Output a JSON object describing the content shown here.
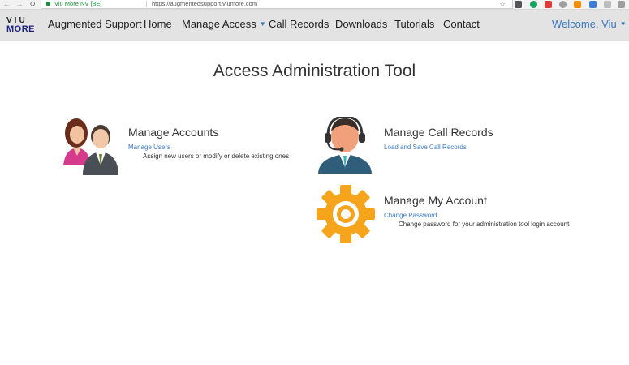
{
  "browser": {
    "site_identity": "Viu More NV [BE]",
    "url": "https://augmentedsupport.viumore.com"
  },
  "navbar": {
    "logo_top": "VIU",
    "logo_bottom": "MORE",
    "items": [
      {
        "label": "Augmented Support"
      },
      {
        "label": "Home"
      },
      {
        "label": "Manage Access"
      },
      {
        "label": "Call Records"
      },
      {
        "label": "Downloads"
      },
      {
        "label": "Tutorials"
      },
      {
        "label": "Contact"
      }
    ],
    "welcome": "Welcome, Viu"
  },
  "main": {
    "title": "Access Administration Tool",
    "cards": [
      {
        "title": "Manage Accounts",
        "link": "Manage Users",
        "description": "Assign new users or modify or delete existing ones",
        "icon": "users-icon"
      },
      {
        "title": "Manage Call Records",
        "link": "Load and Save Call Records",
        "description": "",
        "icon": "headset-operator-icon"
      },
      {
        "title": "Manage My Account",
        "link": "Change Password",
        "description": "Change password for your administration tool login account",
        "icon": "gear-icon"
      }
    ]
  },
  "colors": {
    "navbar_bg": "#e3e3e3",
    "link_blue": "#3a79c4",
    "gear_orange": "#f5a41c",
    "text_dark": "#333333"
  }
}
